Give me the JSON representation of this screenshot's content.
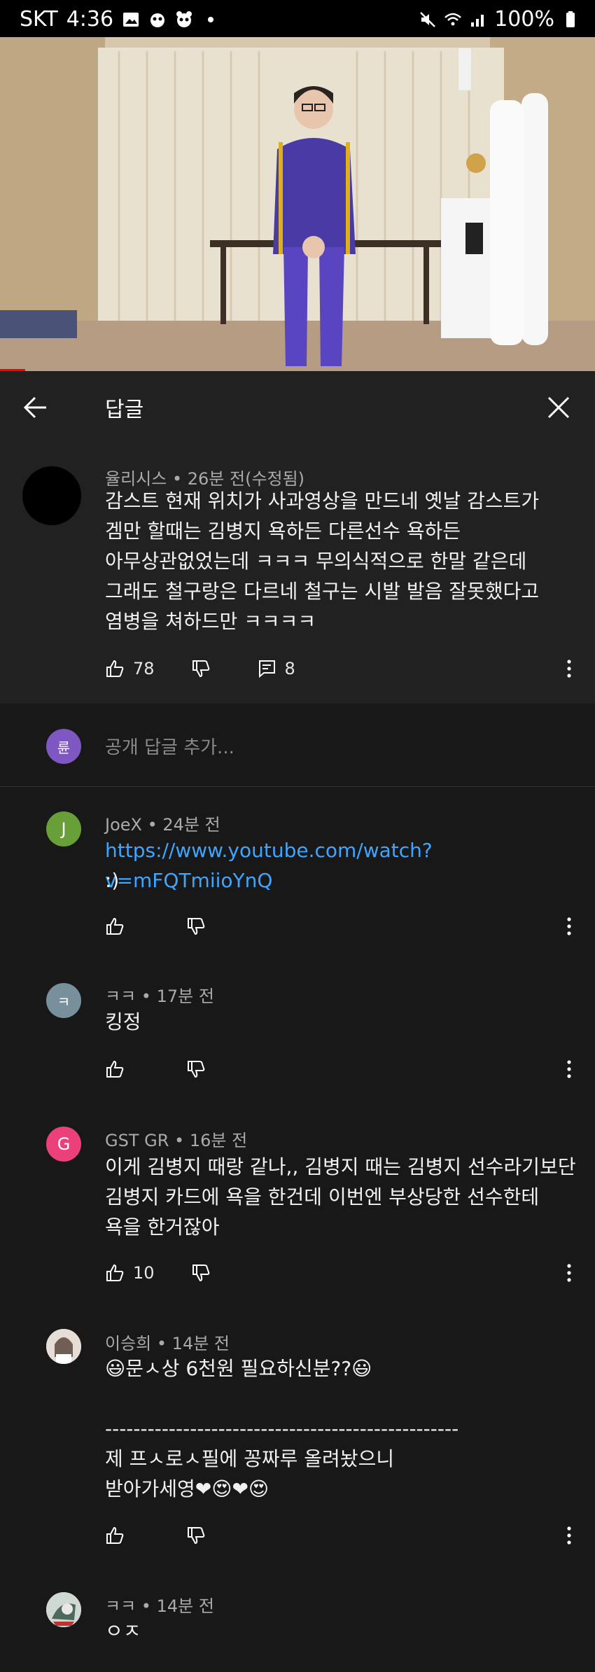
{
  "status_bar": {
    "carrier": "SKT",
    "time": "4:36",
    "battery": "100%"
  },
  "header": {
    "title": "답글"
  },
  "parent_comment": {
    "author": "율리시스",
    "time": "26분 전(수정됨)",
    "text": "감스트 현재 위치가 사과영상을 만드네 옛날 감스트가\n겜만 할때는 김병지 욕하든 다른선수 욕하든\n아무상관없었는데 ㅋㅋㅋ 무의식적으로 한말 같은데\n그래도 철구랑은 다르네 철구는 시발 발음 잘못했다고\n염병을 쳐하드만 ㅋㅋㅋㅋ",
    "likes": "78",
    "replies": "8"
  },
  "add_reply": {
    "avatar_letter": "륜",
    "placeholder": "공개 답글 추가..."
  },
  "replies": [
    {
      "avatar_letter": "J",
      "avatar_color": "#689f38",
      "author": "JoeX",
      "time": "24분 전",
      "link": "https://www.youtube.com/watch?v=mFQTmiioYnQ",
      "text": ":)",
      "likes": ""
    },
    {
      "avatar_letter": "ㅋ",
      "avatar_color": "#78909c",
      "author": "ㅋㅋ",
      "time": "17분 전",
      "text": "킹정",
      "likes": ""
    },
    {
      "avatar_letter": "G",
      "avatar_color": "#ec407a",
      "author": "GST GR",
      "time": "16분 전",
      "text": "이게 김병지 때랑 같나,, 김병지 때는 김병지 선수라기보단\n김병지 카드에 욕을 한건데 이번엔 부상당한 선수한테\n욕을 한거잖아",
      "likes": "10"
    },
    {
      "avatar_letter": "",
      "avatar_color": "#d9cfc8",
      "author": "이승희",
      "time": "14분 전",
      "text": "😃문ㅅ상 6천원 필요하신분??😃\n\n--------------------------------------------------\n제 프ㅅ로ㅅ필에 꽁짜루 올려놨으니\n받아가세영❤😍❤😍",
      "likes": ""
    },
    {
      "avatar_letter": "",
      "avatar_color": "#c5d3c9",
      "author": "ㅋㅋ",
      "time": "14분 전",
      "text": "ㅇㅈ",
      "likes": ""
    }
  ],
  "colors": {
    "background": "#181818",
    "panel": "#212121",
    "link": "#3ea6ff",
    "meta": "#aaaaaa"
  }
}
